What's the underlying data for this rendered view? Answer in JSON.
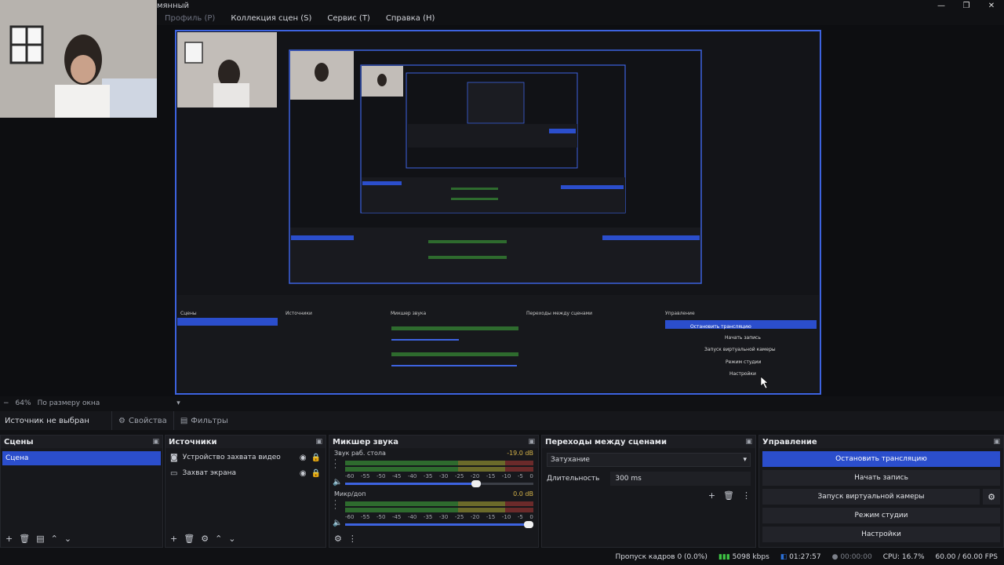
{
  "window": {
    "title": "мянный",
    "minimize": "—",
    "maximize": "❐",
    "close": "✕"
  },
  "menu": {
    "profile": "Профиль (P)",
    "scene_collection": "Коллекция сцен (S)",
    "tools": "Сервис (T)",
    "help": "Справка (H)"
  },
  "zoom": {
    "minus": "−",
    "value": "64%",
    "fit_mode": "По размеру окна",
    "dropdown": "▾"
  },
  "source_toolbar": {
    "no_source": "Источник не выбран",
    "properties": "Свойства",
    "filters": "Фильтры"
  },
  "scenes": {
    "title": "Сцены",
    "items": [
      "Сцена"
    ]
  },
  "sources": {
    "title": "Источники",
    "items": [
      {
        "name": "Устройство захвата видео"
      },
      {
        "name": "Захват экрана"
      }
    ]
  },
  "mixer": {
    "title": "Микшер звука",
    "channels": [
      {
        "name": "Звук раб. стола",
        "db": "-19.0 dB",
        "volume": 0.72
      },
      {
        "name": "Микр/доп",
        "db": "0.0 dB",
        "volume": 1.0
      }
    ],
    "ticks": [
      "-60",
      "-55",
      "-50",
      "-45",
      "-40",
      "-35",
      "-30",
      "-25",
      "-20",
      "-15",
      "-10",
      "-5",
      "0"
    ]
  },
  "transitions": {
    "title": "Переходы между сценами",
    "selected": "Затухание",
    "duration_label": "Длительность",
    "duration_value": "300 ms"
  },
  "controls": {
    "title": "Управление",
    "stop_stream": "Остановить трансляцию",
    "start_recording": "Начать запись",
    "virtual_camera": "Запуск виртуальной камеры",
    "studio_mode": "Режим студии",
    "settings": "Настройки"
  },
  "status": {
    "dropped_frames": "Пропуск кадров 0 (0.0%)",
    "bitrate": "5098 kbps",
    "stream_time": "01:27:57",
    "rec_time": "00:00:00",
    "cpu": "CPU: 16.7%",
    "fps": "60.00 / 60.00 FPS"
  },
  "colors": {
    "accent": "#2b4ecc",
    "background": "#101114",
    "dock": "#17181c",
    "signal": "#3ec444"
  }
}
